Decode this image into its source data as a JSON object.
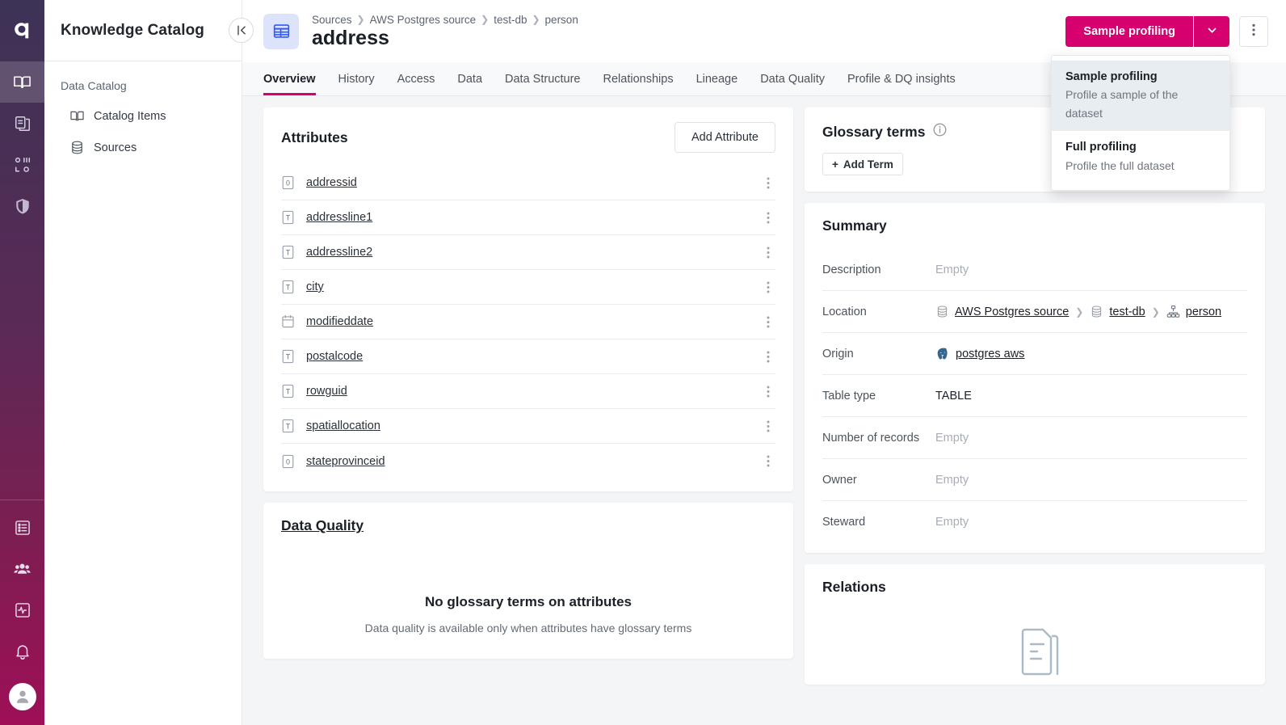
{
  "rail": {
    "logo": "ataccama-logo",
    "items": [
      {
        "name": "book-icon",
        "label": "Knowledge Catalog",
        "active": true
      },
      {
        "name": "clipboard-copy-icon",
        "label": "Data Stories",
        "active": false
      },
      {
        "name": "data-flow-icon",
        "label": "Data Processing",
        "active": false
      },
      {
        "name": "shield-icon",
        "label": "Data Privacy",
        "active": false
      }
    ],
    "bottom_items": [
      {
        "name": "list-icon",
        "label": "Tasks"
      },
      {
        "name": "people-icon",
        "label": "Users"
      },
      {
        "name": "monitoring-icon",
        "label": "Monitoring"
      },
      {
        "name": "bell-icon",
        "label": "Notifications"
      }
    ],
    "avatar": "user-avatar"
  },
  "sidebar": {
    "title": "Knowledge Catalog",
    "collapse_label": "Collapse sidebar",
    "section_label": "Data Catalog",
    "items": [
      {
        "label": "Catalog Items",
        "icon": "book-icon"
      },
      {
        "label": "Sources",
        "icon": "database-icon"
      }
    ]
  },
  "header": {
    "entity_icon": "table-icon",
    "breadcrumb": [
      "Sources",
      "AWS Postgres source",
      "test-db",
      "person"
    ],
    "title": "address",
    "primary_button": "Sample profiling",
    "caret_label": "Open profiling options",
    "kebab_label": "More actions",
    "accent_color": "#d6006e"
  },
  "dropdown": {
    "visible": true,
    "items": [
      {
        "title": "Sample profiling",
        "subtitle": "Profile a sample of the dataset",
        "active": true
      },
      {
        "title": "Full profiling",
        "subtitle": "Profile the full dataset",
        "active": false
      }
    ]
  },
  "tabs": [
    {
      "label": "Overview",
      "active": true
    },
    {
      "label": "History",
      "active": false
    },
    {
      "label": "Access",
      "active": false
    },
    {
      "label": "Data",
      "active": false
    },
    {
      "label": "Data Structure",
      "active": false
    },
    {
      "label": "Relationships",
      "active": false
    },
    {
      "label": "Lineage",
      "active": false
    },
    {
      "label": "Data Quality",
      "active": false
    },
    {
      "label": "Profile & DQ insights",
      "active": false
    }
  ],
  "attributes_card": {
    "title": "Attributes",
    "add_button": "Add Attribute",
    "rows": [
      {
        "name": "addressid",
        "type": "number"
      },
      {
        "name": "addressline1",
        "type": "text"
      },
      {
        "name": "addressline2",
        "type": "text"
      },
      {
        "name": "city",
        "type": "text"
      },
      {
        "name": "modifieddate",
        "type": "date"
      },
      {
        "name": "postalcode",
        "type": "text"
      },
      {
        "name": "rowguid",
        "type": "text"
      },
      {
        "name": "spatiallocation",
        "type": "text"
      },
      {
        "name": "stateprovinceid",
        "type": "number"
      }
    ]
  },
  "data_quality_card": {
    "title": "Data Quality",
    "empty_title": "No glossary terms on attributes",
    "empty_subtitle": "Data quality is available only when attributes have glossary terms"
  },
  "glossary_card": {
    "title": "Glossary terms",
    "info_icon": "info-icon",
    "add_term_button": "Add Term"
  },
  "summary_card": {
    "title": "Summary",
    "rows": [
      {
        "label": "Description",
        "value": "Empty",
        "empty": true
      },
      {
        "label": "Location",
        "type": "location",
        "empty": false
      },
      {
        "label": "Origin",
        "type": "origin",
        "value": "postgres aws",
        "empty": false
      },
      {
        "label": "Table type",
        "value": "TABLE",
        "empty": false
      },
      {
        "label": "Number of records",
        "value": "Empty",
        "empty": true
      },
      {
        "label": "Owner",
        "value": "Empty",
        "empty": true
      },
      {
        "label": "Steward",
        "value": "Empty",
        "empty": true
      }
    ],
    "location_path": [
      {
        "label": "AWS Postgres source",
        "icon": "database-icon"
      },
      {
        "label": "test-db",
        "icon": "database-icon"
      },
      {
        "label": "person",
        "icon": "schema-icon"
      }
    ],
    "origin_icon": "postgresql-icon"
  },
  "relations_card": {
    "title": "Relations",
    "illustration": "documents-illustration"
  }
}
